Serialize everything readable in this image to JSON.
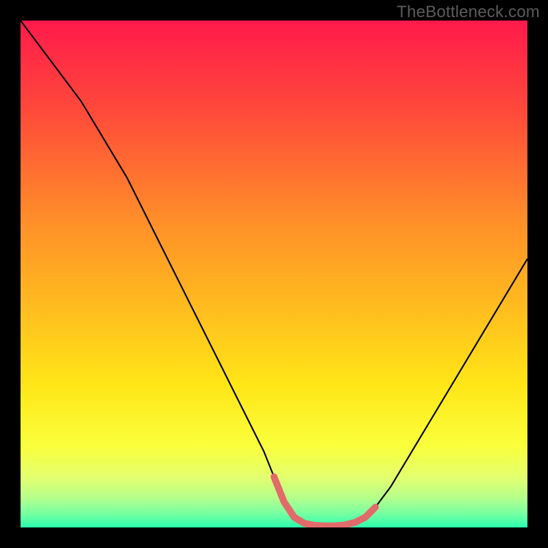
{
  "watermark": "TheBottleneck.com",
  "chart_data": {
    "type": "line",
    "title": "",
    "xlabel": "",
    "ylabel": "",
    "xlim": [
      0,
      100
    ],
    "ylim": [
      0,
      100
    ],
    "background_gradient": {
      "stops": [
        {
          "offset": 0.0,
          "color": "#ff1a4b"
        },
        {
          "offset": 0.18,
          "color": "#ff4a3a"
        },
        {
          "offset": 0.38,
          "color": "#ff8a2a"
        },
        {
          "offset": 0.55,
          "color": "#ffb81f"
        },
        {
          "offset": 0.72,
          "color": "#ffe617"
        },
        {
          "offset": 0.84,
          "color": "#faff3c"
        },
        {
          "offset": 0.9,
          "color": "#e4ff6e"
        },
        {
          "offset": 0.94,
          "color": "#b7ff8a"
        },
        {
          "offset": 0.97,
          "color": "#7dffa0"
        },
        {
          "offset": 1.0,
          "color": "#2bffad"
        }
      ]
    },
    "series": [
      {
        "name": "bottleneck-curve",
        "stroke": "#000000",
        "stroke_width": 2.2,
        "x": [
          0,
          3,
          6,
          9,
          12,
          15,
          18,
          21,
          24,
          27,
          30,
          33,
          36,
          39,
          42,
          45,
          48,
          50,
          52,
          54,
          56,
          58,
          60,
          62,
          64,
          66,
          68,
          70,
          73,
          76,
          79,
          82,
          85,
          88,
          91,
          94,
          97,
          100
        ],
        "y": [
          100,
          96,
          92,
          88,
          84,
          79,
          74,
          69,
          63,
          57,
          51,
          45,
          39,
          33,
          27,
          21,
          15,
          10,
          5,
          2,
          0.8,
          0.4,
          0.3,
          0.3,
          0.5,
          1.0,
          2.0,
          4.0,
          8.0,
          13,
          18,
          23,
          28,
          33,
          38,
          43,
          48,
          53
        ]
      },
      {
        "name": "valley-highlight",
        "stroke": "#e26a6a",
        "stroke_width": 10,
        "linecap": "round",
        "x": [
          50,
          52,
          54,
          56,
          58,
          60,
          62,
          64,
          66,
          68,
          70
        ],
        "y": [
          10,
          5,
          2,
          0.8,
          0.4,
          0.3,
          0.3,
          0.5,
          1.0,
          2.0,
          4.0
        ]
      }
    ]
  }
}
